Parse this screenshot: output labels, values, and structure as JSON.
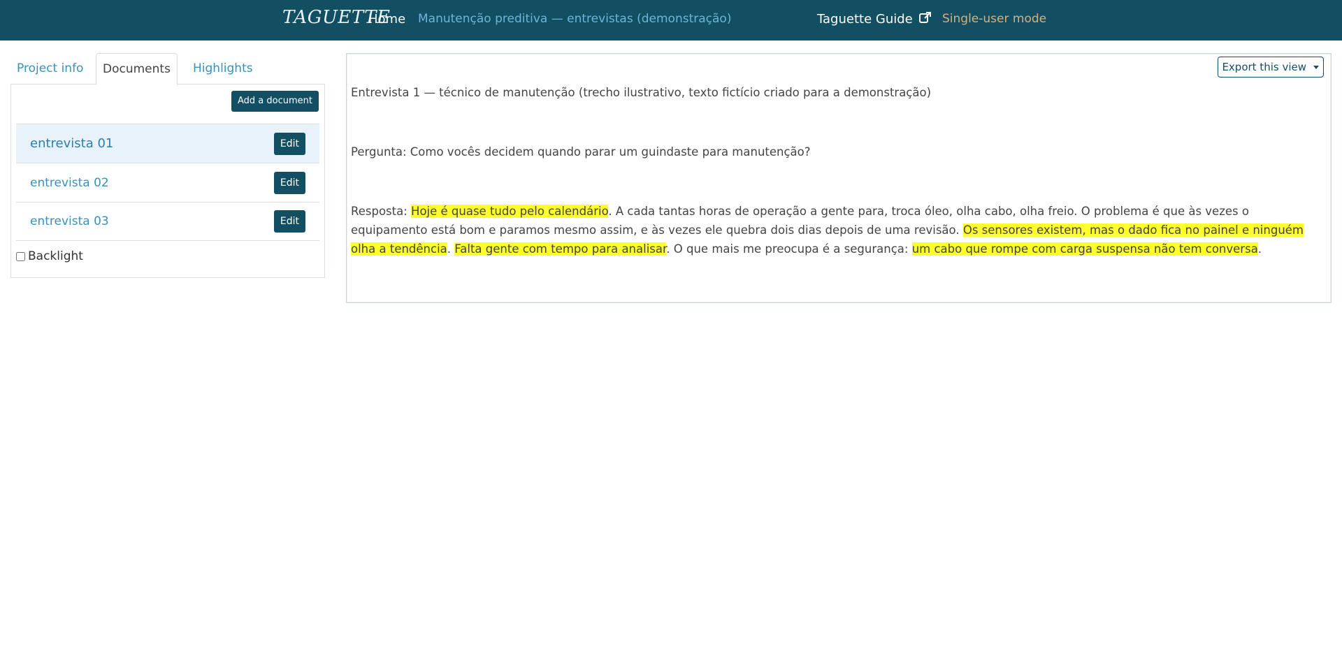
{
  "navbar": {
    "brand": "TAGUETTE",
    "home": "Home",
    "project": "Manutenção preditiva — entrevistas (demonstração)",
    "guide": "Taguette Guide",
    "guide_icon": "external-link-icon",
    "mode": "Single-user mode"
  },
  "tabs": {
    "info": "Project info",
    "documents": "Documents",
    "highlights": "Highlights"
  },
  "documents": {
    "add_label": "Add a document",
    "edit_label": "Edit",
    "items": [
      {
        "name": "entrevista 01",
        "active": true
      },
      {
        "name": "entrevista 02",
        "active": false
      },
      {
        "name": "entrevista 03",
        "active": false
      }
    ],
    "backlight_label": "Backlight"
  },
  "view": {
    "export_label": "Export this view",
    "p1": "Entrevista 1 — técnico de manutenção (trecho ilustrativo, texto fictício criado para a demonstração)",
    "p2": "Pergunta: Como vocês decidem quando parar um guindaste para manutenção?",
    "p3_a": "Resposta: ",
    "p3_h1": "Hoje é quase tudo pelo calendário",
    "p3_b": ". A cada tantas horas de operação a gente para, troca óleo, olha cabo, olha freio. O problema é que às vezes o equipamento está bom e paramos mesmo assim, e às vezes ele quebra dois dias depois de uma revisão. ",
    "p3_h2": "Os sensores existem, mas o dado fica no painel e ninguém olha a tendência",
    "p3_c": ". ",
    "p3_h3": "Falta gente com tempo para analisar",
    "p3_d": ". O que mais me preocupa é a segurança: ",
    "p3_h4": "um cabo que rompe com carga suspensa não tem conversa",
    "p3_e": "."
  },
  "colors": {
    "navbar": "#124f63",
    "link": "#3a90bd",
    "mode": "#d9b07a",
    "highlight": "#ffff2e",
    "active_row": "#e8f2fb"
  }
}
